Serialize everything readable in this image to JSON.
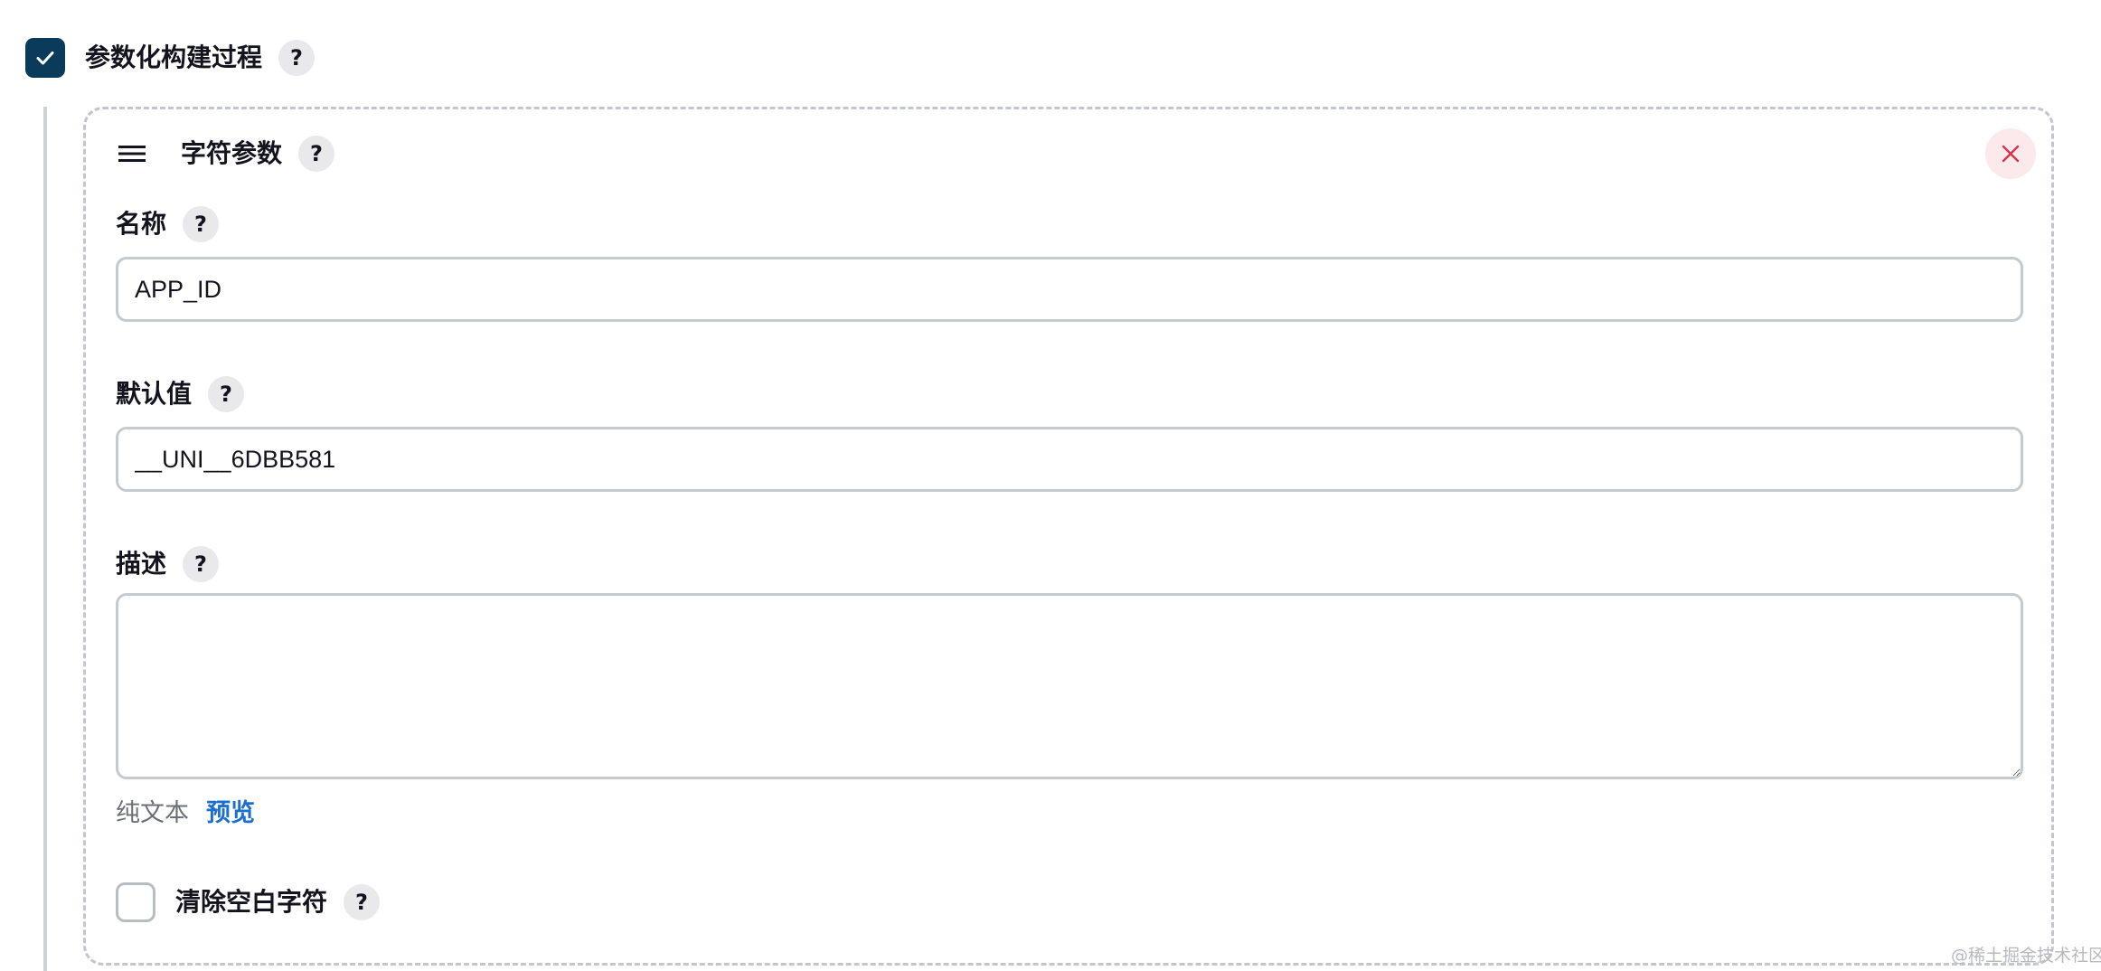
{
  "build": {
    "parameterized_label": "参数化构建过程",
    "parameterized_checked": true,
    "help_label": "?"
  },
  "param": {
    "type_title": "字符参数",
    "help_label": "?",
    "name": {
      "label": "名称",
      "value": "APP_ID"
    },
    "default": {
      "label": "默认值",
      "value": "__UNI__6DBB581"
    },
    "description": {
      "label": "描述",
      "value": ""
    },
    "format": {
      "plain_text": "纯文本",
      "preview": "预览"
    },
    "trim": {
      "label": "清除空白字符",
      "checked": false
    }
  },
  "colors": {
    "checkbox_checked": "#0b3b5a",
    "close_bg": "#fbe9eb",
    "close_icon": "#d9344b",
    "link": "#1a6fd1"
  },
  "icons": {
    "check": "check-icon",
    "drag": "drag-handle-icon",
    "close": "close-icon",
    "help": "help-icon"
  },
  "watermark": "@稀土掘金技术社区"
}
